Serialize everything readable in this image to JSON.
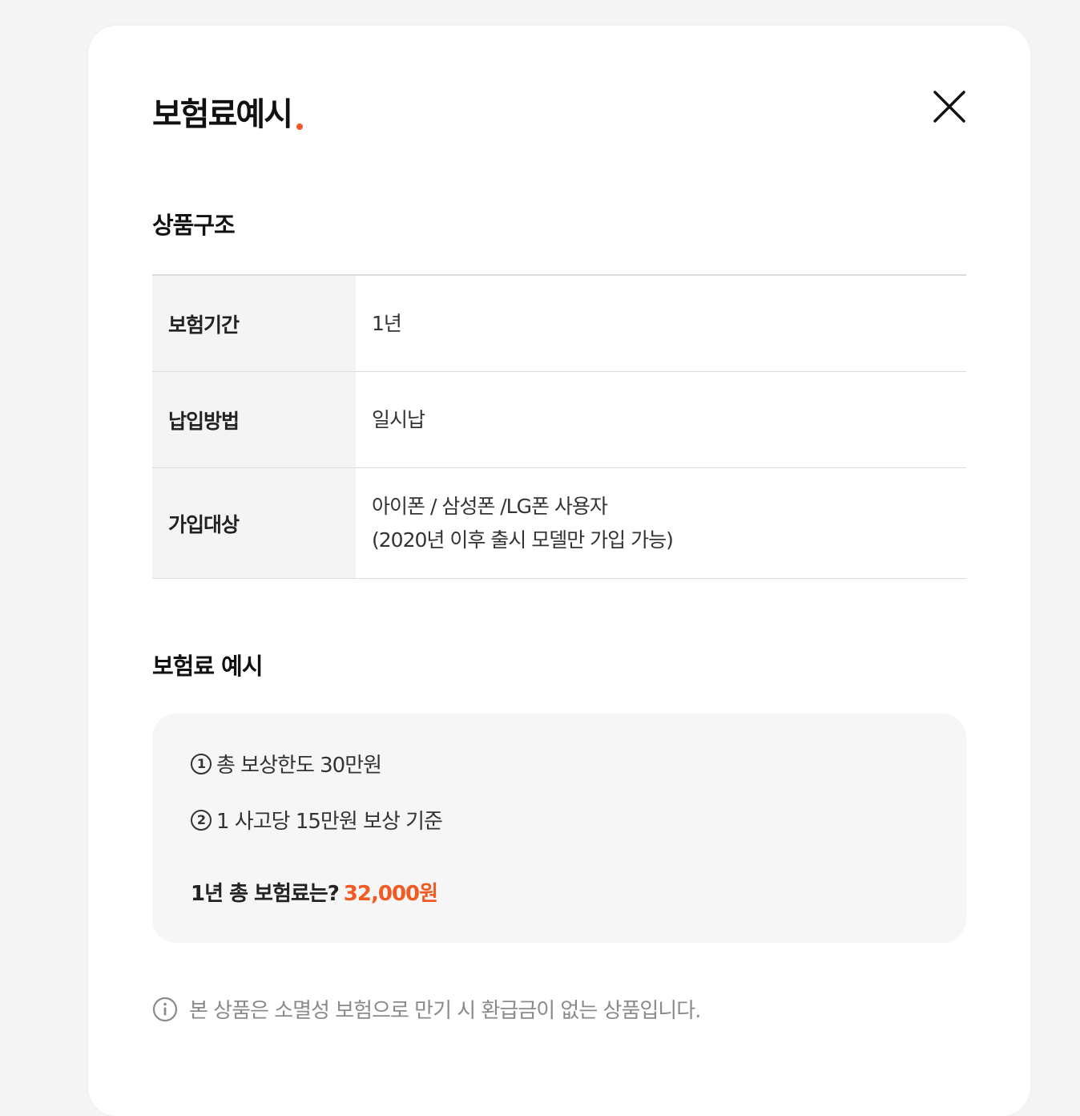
{
  "modal": {
    "title": "보험료예시",
    "accent_color": "#f15a22",
    "close_icon": "close-icon"
  },
  "structure": {
    "title": "상품구조",
    "rows": [
      {
        "label": "보험기간",
        "value": [
          "1년"
        ]
      },
      {
        "label": "납입방법",
        "value": [
          "일시납"
        ]
      },
      {
        "label": "가입대상",
        "value": [
          "아이폰 / 삼성폰 /LG폰 사용자",
          "(2020년 이후 출시 모델만 가입 가능)"
        ]
      }
    ]
  },
  "example": {
    "title": "보험료 예시",
    "items": [
      {
        "num": "1",
        "text": "총 보상한도 30만원"
      },
      {
        "num": "2",
        "text": "1 사고당 15만원 보상 기준"
      }
    ],
    "total_label": "1년 총 보험료는?",
    "total_amount": "32,000원"
  },
  "notice": {
    "icon": "info-icon",
    "text": "본 상품은 소멸성 보험으로 만기 시 환급금이 없는 상품입니다."
  }
}
